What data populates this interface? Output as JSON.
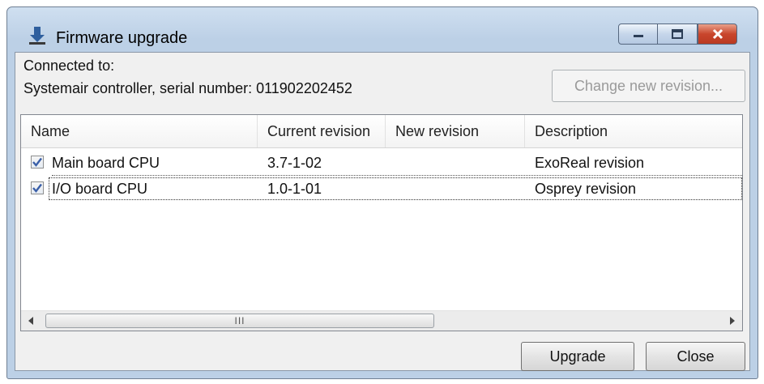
{
  "window": {
    "title": "Firmware upgrade"
  },
  "connection": {
    "label": "Connected to:",
    "device": "Systemair controller, serial number: 011902202452"
  },
  "change_revision_button": {
    "label": "Change new revision...",
    "enabled": false
  },
  "table": {
    "columns": [
      "Name",
      "Current revision",
      "New revision",
      "Description"
    ],
    "rows": [
      {
        "checked": true,
        "name": "Main board CPU",
        "current_revision": "3.7-1-02",
        "new_revision": "",
        "description": "ExoReal revision"
      },
      {
        "checked": true,
        "name": "I/O board CPU",
        "current_revision": "1.0-1-01",
        "new_revision": "",
        "description": "Osprey revision"
      }
    ]
  },
  "scrollbar": {
    "thumb_glyph": "III"
  },
  "footer": {
    "upgrade_label": "Upgrade",
    "close_label": "Close"
  },
  "icons": {
    "app": "firmware-download-icon",
    "minimize": "minimize-icon",
    "maximize": "maximize-icon",
    "close": "close-icon",
    "scroll_left": "scroll-left-arrow-icon",
    "scroll_right": "scroll-right-arrow-icon",
    "checkbox": "checkmark-icon"
  },
  "colors": {
    "close_button": "#c9462c",
    "check": "#3a5fa8",
    "frame": "#bcd0e6"
  }
}
